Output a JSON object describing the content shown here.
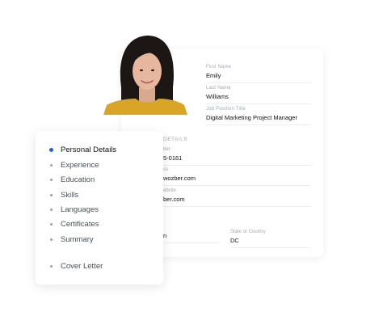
{
  "form": {
    "first_name": {
      "label": "First Name",
      "value": "Emily"
    },
    "last_name": {
      "label": "Last Name",
      "value": "Williams"
    },
    "job_title": {
      "label": "Job Position Title",
      "value": "Digital Marketing Project Manager"
    },
    "section_title": "DETAILS",
    "phone": {
      "label": "ber",
      "value": "5-0161"
    },
    "email": {
      "label": "ss",
      "value": "wozber.com"
    },
    "website": {
      "label": "ebsite",
      "value": "ber.com"
    },
    "city": {
      "label": "",
      "value": "n"
    },
    "state": {
      "label": "State or Country",
      "value": "DC"
    }
  },
  "nav": {
    "items": [
      {
        "label": "Personal Details",
        "active": true
      },
      {
        "label": "Experience",
        "active": false
      },
      {
        "label": "Education",
        "active": false
      },
      {
        "label": "Skills",
        "active": false
      },
      {
        "label": "Languages",
        "active": false
      },
      {
        "label": "Certificates",
        "active": false
      },
      {
        "label": "Summary",
        "active": false
      },
      {
        "label": "Cover Letter",
        "active": false
      }
    ]
  },
  "colors": {
    "accent": "#1f5fd6",
    "sweater": "#d9a526"
  }
}
